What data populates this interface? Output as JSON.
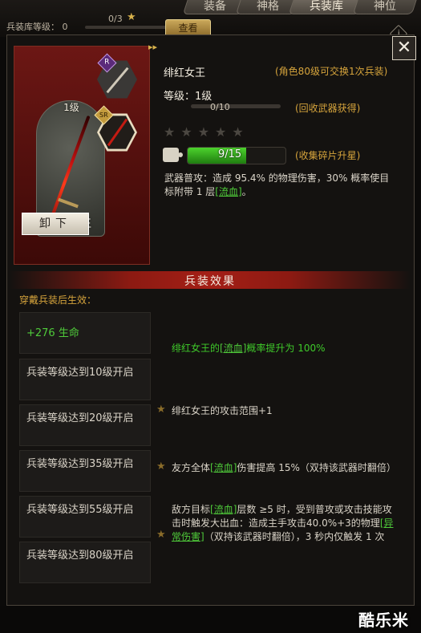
{
  "tabs": [
    {
      "label": "装备",
      "active": false
    },
    {
      "label": "神格",
      "active": false
    },
    {
      "label": "兵装库",
      "active": true
    },
    {
      "label": "神位",
      "active": false
    }
  ],
  "armory": {
    "level_label": "兵装库等级：",
    "level_value": "0",
    "progress": 0,
    "count": "0/3",
    "star": "★",
    "view_label": "查看",
    "info_icon": "i"
  },
  "close": {
    "glyph": "✕"
  },
  "weapon": {
    "level_tag": "1级",
    "name": "绯红女王",
    "unequip_label": "卸下",
    "badge_r": "R",
    "badge_sr": "SR",
    "arrow": "▸▸",
    "title": "绯红女王",
    "exchange_note": "(角色80级可交换1次兵装)",
    "level_line": "等级：1级",
    "level_progress": 0,
    "level_count": "0/10",
    "level_note": "(回收武器获得)",
    "stars_filled": 0,
    "stars_total": 5,
    "stars_display": "★★★★★",
    "fragments": {
      "current": 9,
      "needed": 15,
      "label": "9/15",
      "note": "(收集碎片升星)"
    },
    "skill": {
      "pre": "武器普攻：造成 95.4% 的物理伤害，30% 概率使目标附带 1 层",
      "link": "[流血]",
      "post": "。"
    }
  },
  "effects": {
    "header": "兵装效果",
    "subtitle": "穿戴兵装后生效：",
    "requirements": [
      "+276 生命",
      "兵装等级达到10级开启",
      "兵装等级达到20级开启",
      "兵装等级达到35级开启",
      "兵装等级达到55级开启",
      "兵装等级达到80级开启"
    ],
    "items": [
      {
        "pre": "绯红女王的",
        "link": "[流血]",
        "post": "概率提升为 100%"
      },
      {
        "text": "绯红女王的攻击范围+1"
      },
      {
        "pre": "友方全体",
        "link": "[流血]",
        "post": "伤害提高 15%（双持该武器时翻倍）"
      },
      {
        "pre": "敌方目标",
        "link": "[流血]",
        "mid": "层数 ≥5 时，受到普攻或攻击技能攻击时触发大出血：造成主手攻击40.0%+3的物理",
        "link2": "[异常伤害]",
        "post": "（双持该武器时翻倍），3 秒内仅触发 1 次"
      }
    ],
    "star": "★"
  },
  "watermark": "酷乐米"
}
